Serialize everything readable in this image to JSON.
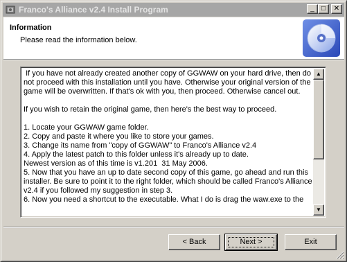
{
  "window": {
    "title": "Franco's Alliance v2.4 Install Program",
    "controls": {
      "minimize": "_",
      "maximize": "□",
      "close": "✕"
    }
  },
  "header": {
    "title": "Information",
    "subtitle": "Please read the information below.",
    "icon": "cd-disc-icon"
  },
  "info_text": " If you have not already created another copy of GGWAW on your hard drive, then do not proceed with this installation until you have. Otherwise your original version of the game will be overwritten. If that's ok with you, then proceed. Otherwise cancel out.\n\nIf you wish to retain the original game, then here's the best way to proceed.\n\n1. Locate your GGWAW game folder.\n2. Copy and paste it where you like to store your games.\n3. Change its name from \"copy of GGWAW\" to Franco's Alliance v2.4\n4. Apply the latest patch to this folder unless it's already up to date.\nNewest version as of this time is v1.201  31 May 2006.\n5. Now that you have an up to date second copy of this game, go ahead and run this installer. Be sure to point it to the right folder, which should be called Franco's Alliance v2.4 if you followed my suggestion in step 3.\n6. Now you need a shortcut to the executable. What I do is drag the waw.exe to the",
  "buttons": {
    "back": "< Back",
    "next": "Next >",
    "exit": "Exit"
  }
}
